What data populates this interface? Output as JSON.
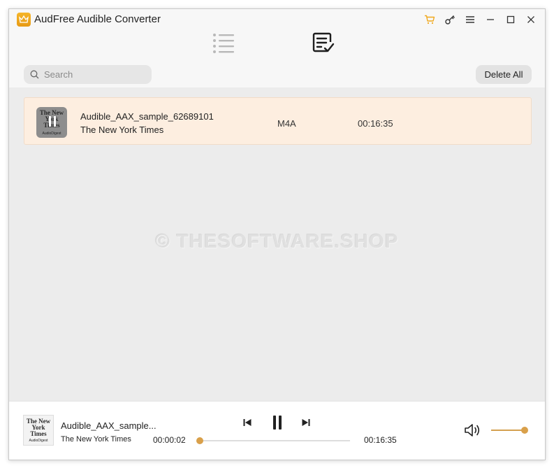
{
  "app": {
    "title": "AudFree Audible Converter",
    "accent_color": "#f0a81e"
  },
  "titlebar_icons": [
    {
      "name": "cart-icon"
    },
    {
      "name": "key-icon"
    },
    {
      "name": "menu-icon"
    },
    {
      "name": "minimize-icon"
    },
    {
      "name": "maximize-icon"
    },
    {
      "name": "close-icon"
    }
  ],
  "tabs": {
    "list_icon": "list-icon",
    "converted_icon": "converted-list-icon"
  },
  "toolbar": {
    "search_placeholder": "Search",
    "delete_all_label": "Delete All"
  },
  "files": [
    {
      "title": "Audible_AAX_sample_62689101",
      "author": "The New York Times",
      "format": "M4A",
      "duration": "00:16:35",
      "cover_text": "The New York Times",
      "cover_sub": "AudioDigest"
    }
  ],
  "watermark": "© THESOFTWARE.SHOP",
  "player": {
    "title": "Audible_AAX_sample...",
    "author": "The New York Times",
    "elapsed": "00:00:02",
    "total": "00:16:35",
    "progress_fraction": 0.002,
    "volume_fraction": 1.0,
    "cover_text": "The New York Times",
    "cover_sub": "AudioDigest"
  }
}
